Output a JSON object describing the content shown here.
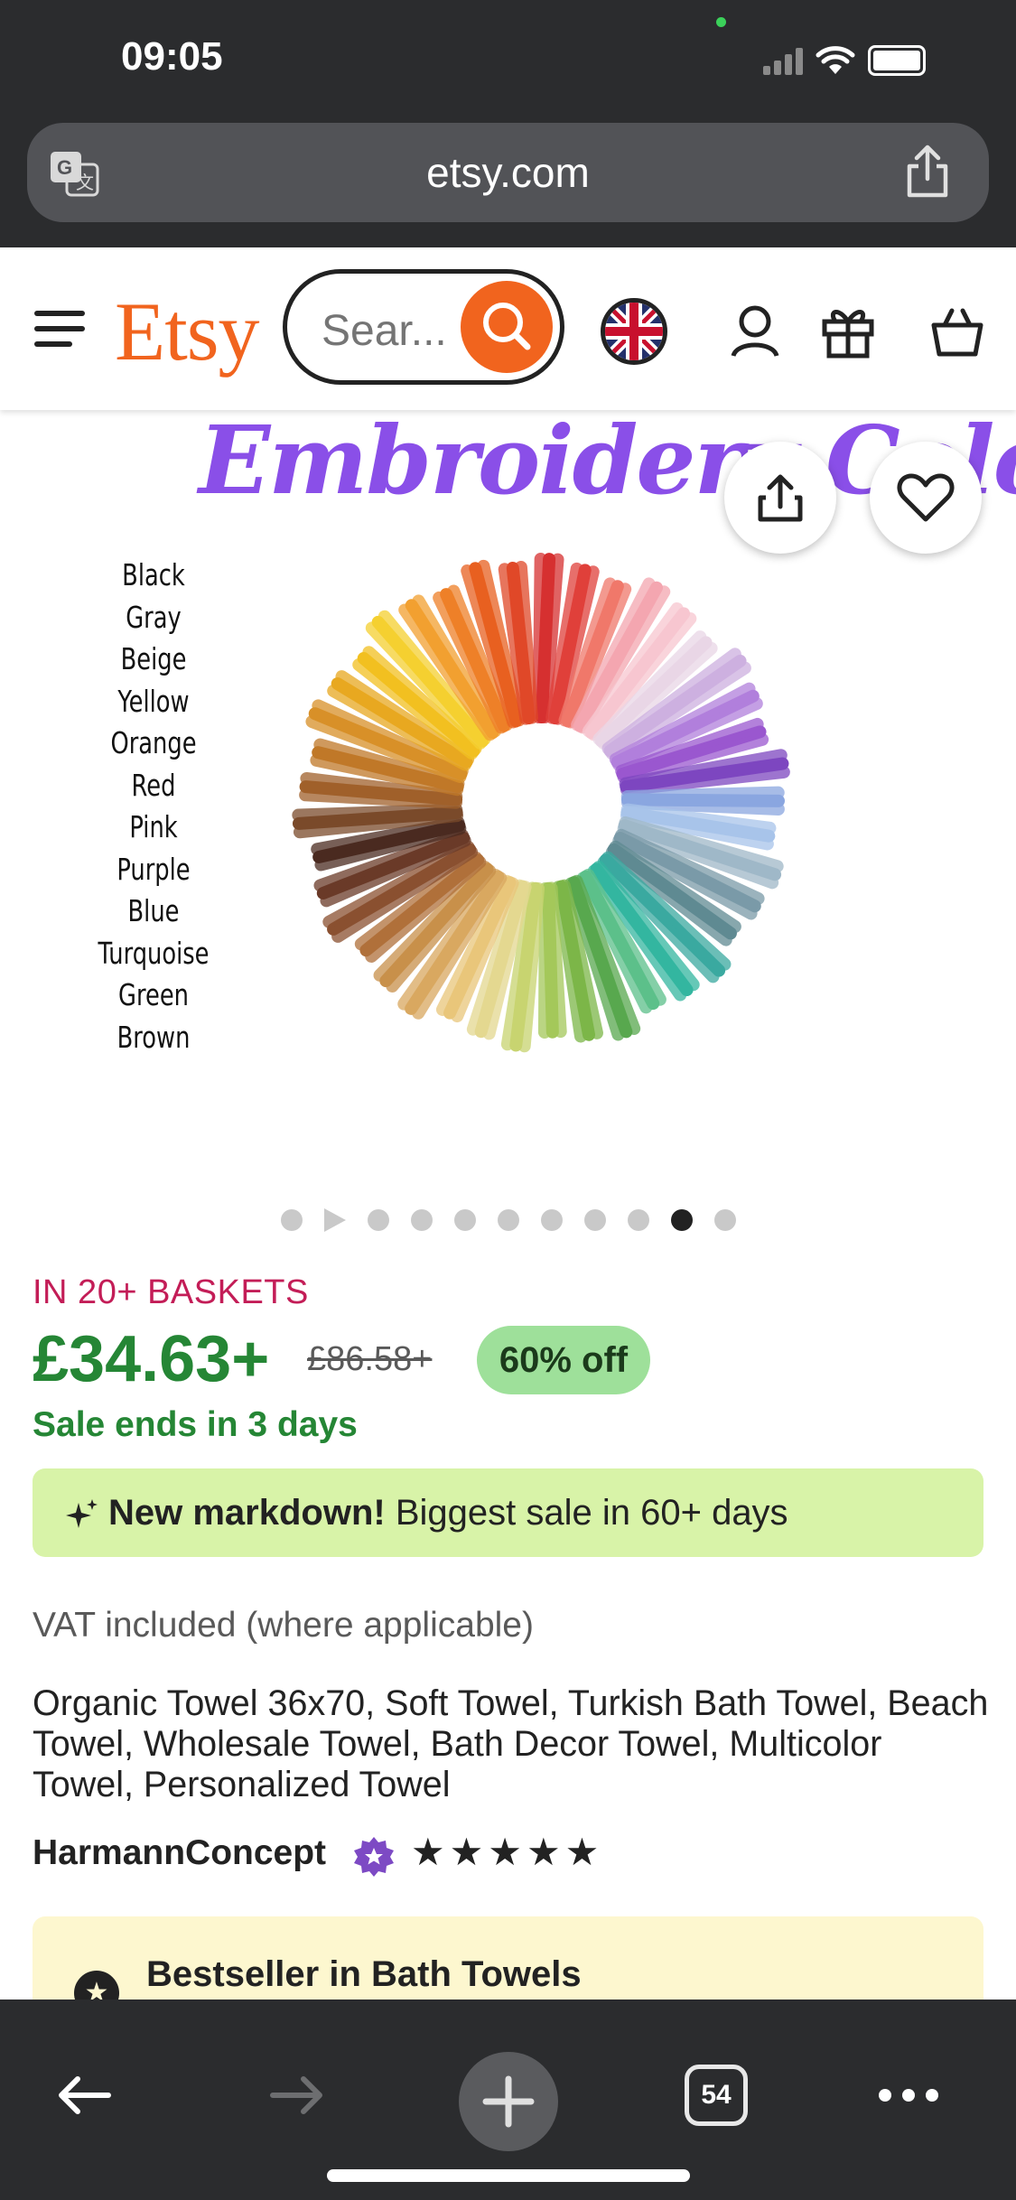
{
  "status_bar": {
    "time": "09:05"
  },
  "browser": {
    "url": "etsy.com",
    "tab_count": "54"
  },
  "header": {
    "logo": "Etsy",
    "search_placeholder": "Sear..."
  },
  "hero": {
    "title": "Embroidery Colors",
    "color_names": [
      "Black",
      "Gray",
      "Beige",
      "Yellow",
      "Orange",
      "Red",
      "Pink",
      "Purple",
      "Blue",
      "Turquoise",
      "Green",
      "Brown"
    ],
    "image_count": 11,
    "active_image_index": 9
  },
  "listing": {
    "baskets": "IN 20+ BASKETS",
    "price": "£34.63+",
    "original_price": "£86.58+",
    "discount": "60% off",
    "sale_ends": "Sale ends in 3 days",
    "markdown_bold": "New markdown!",
    "markdown_rest": " Biggest sale in 60+ days",
    "vat": "VAT included (where applicable)",
    "title": "Organic Towel 36x70, Soft Towel, Turkish Bath Towel, Beach Towel, Wholesale Towel, Bath Decor Towel, Multicolor Towel, Personalized Towel",
    "seller": "HarmannConcept",
    "rating_stars": "★★★★★",
    "bestseller": "Bestseller in Bath Towels"
  },
  "colors": {
    "etsy_orange": "#f1641e",
    "price_green": "#258635",
    "basket_red": "#c31d57",
    "badge_green": "#9ee09a",
    "markdown_bg": "#d8f3a8",
    "bestseller_bg": "#fdf7cf",
    "hero_purple": "#8a4fe8"
  }
}
